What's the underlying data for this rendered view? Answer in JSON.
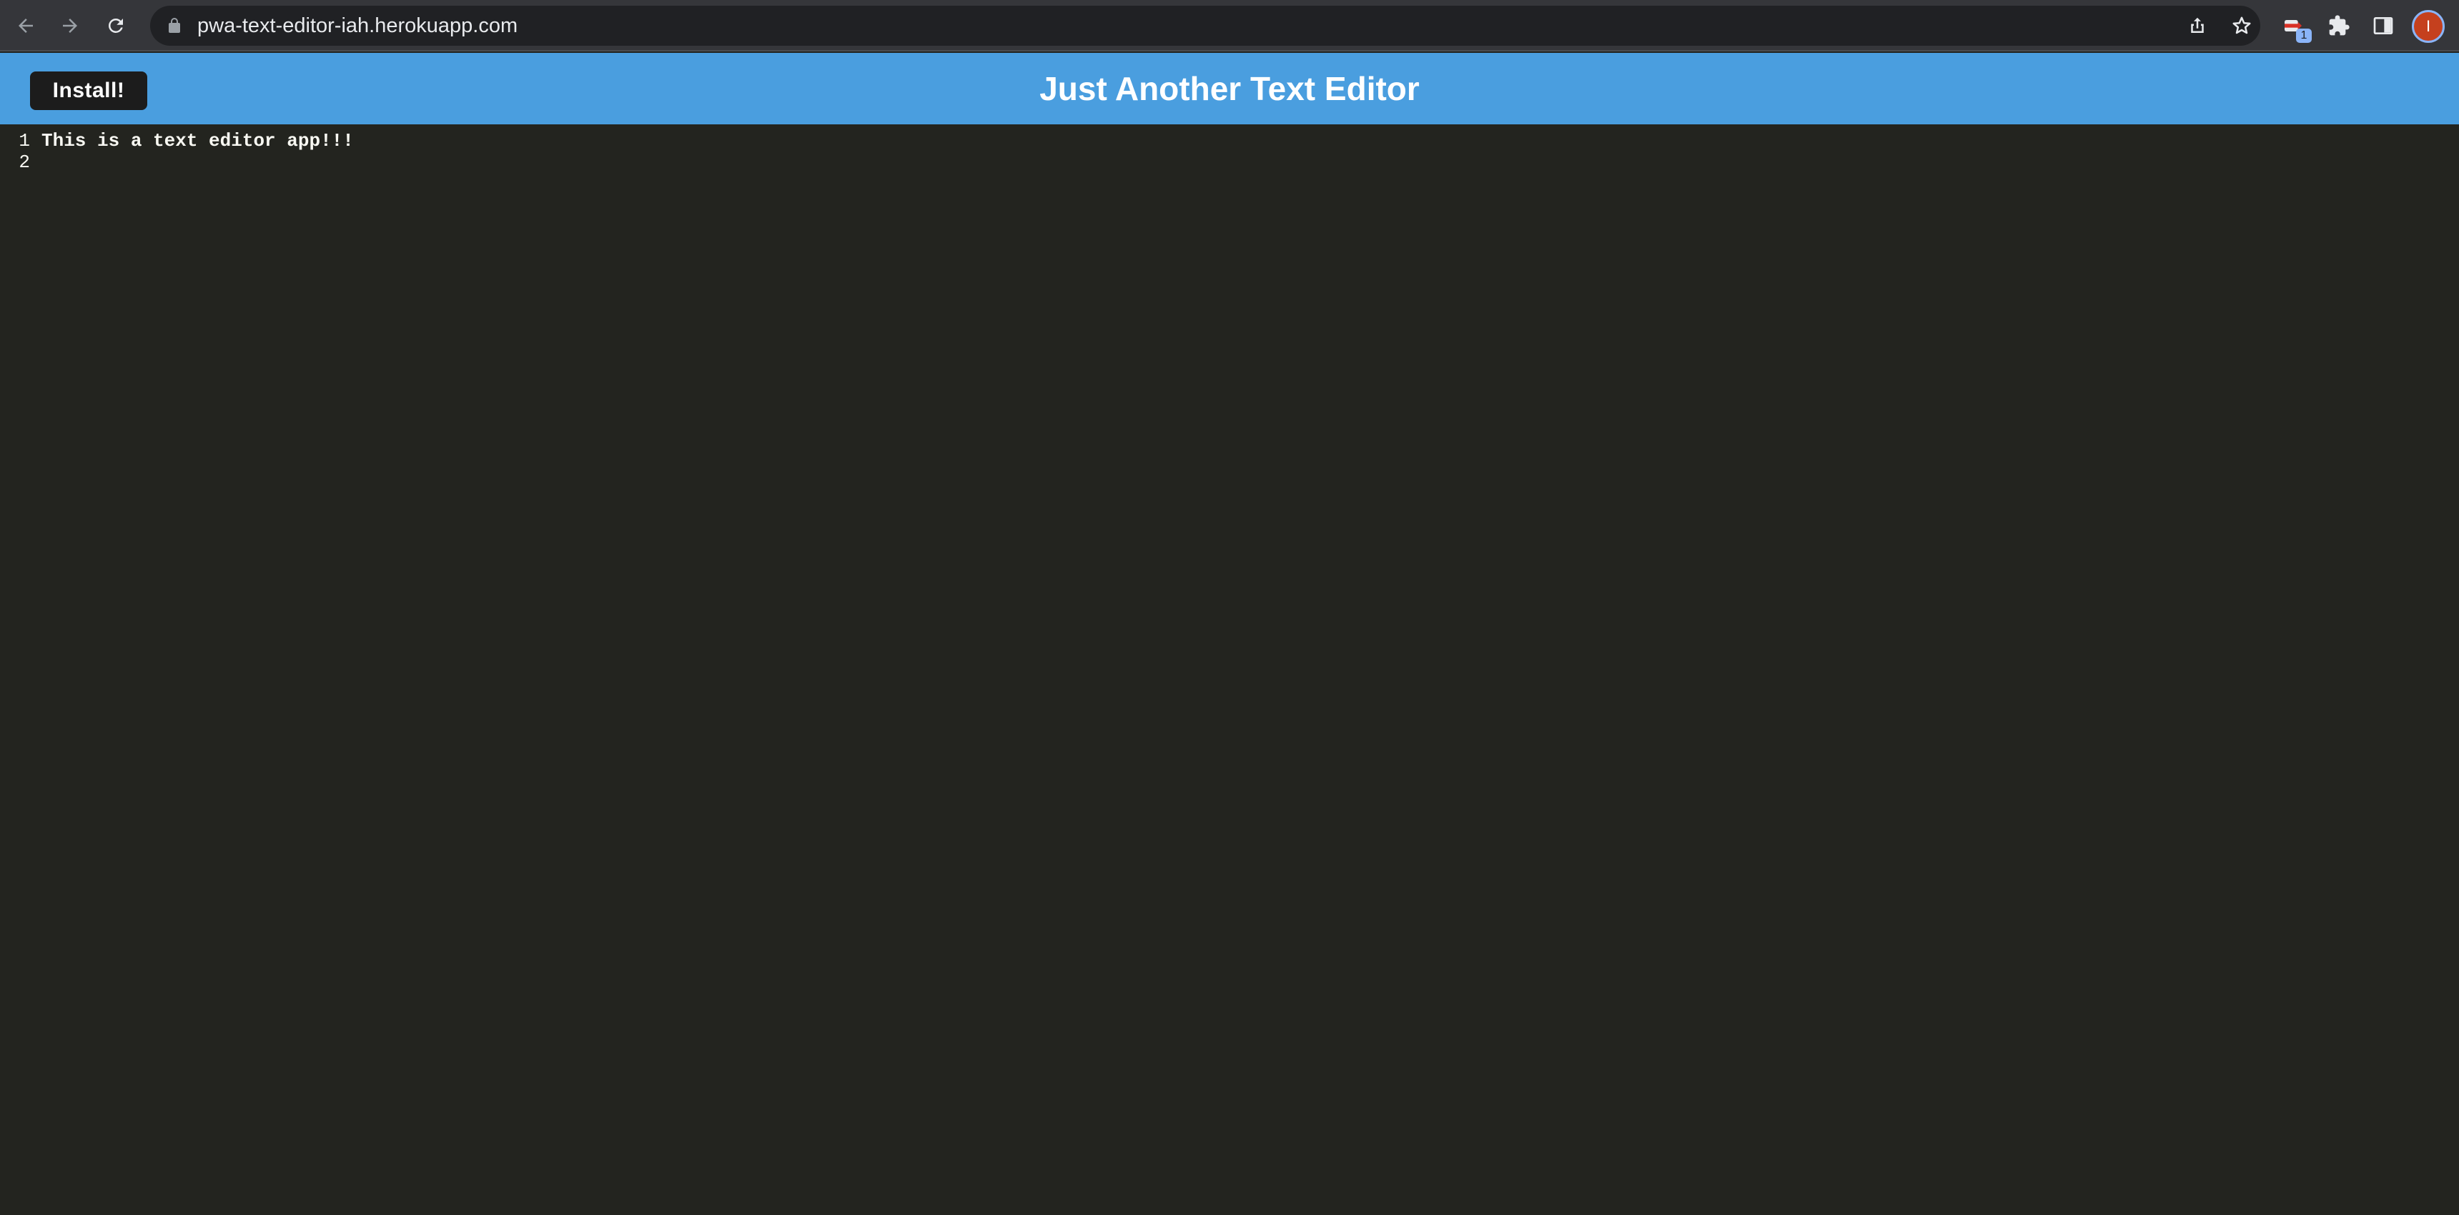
{
  "browser": {
    "url": "pwa-text-editor-iah.herokuapp.com",
    "extension_badge": "1",
    "profile_initial": "I"
  },
  "app": {
    "install_label": "Install!",
    "title": "Just Another Text Editor"
  },
  "editor": {
    "lines": [
      {
        "number": "1",
        "text": "This is a text editor app!!!"
      },
      {
        "number": "2",
        "text": ""
      }
    ]
  },
  "colors": {
    "header": "#4a9edf",
    "editor_background": "#23241f",
    "install_button": "#1c1c1c"
  }
}
